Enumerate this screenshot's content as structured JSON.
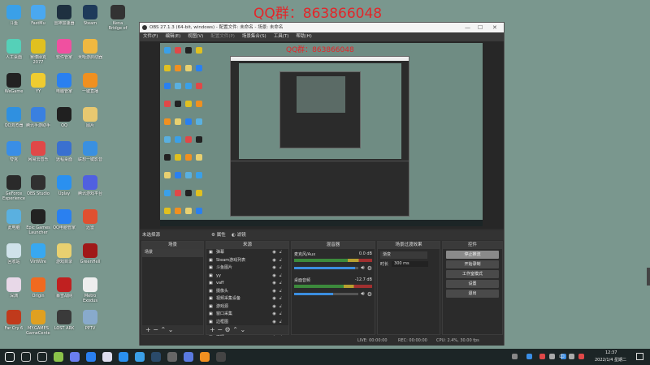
{
  "watermark": "QQ群：863866048",
  "desktop_icons": [
    {
      "label": "斗鱼",
      "color": "#3aa0e8"
    },
    {
      "label": "人工桌面",
      "color": "#55d0b8"
    },
    {
      "label": "WeGame",
      "color": "#222"
    },
    {
      "label": "QQ浏览器",
      "color": "#2f90e0"
    },
    {
      "label": "夸克",
      "color": "#3a8ee6"
    },
    {
      "label": "GeForce Experience",
      "color": "#2a2a2a"
    },
    {
      "label": "此电脑",
      "color": "#5ab0e0"
    },
    {
      "label": "回收站",
      "color": "#cfe2ea"
    },
    {
      "label": "深渊",
      "color": "#e8d8e8"
    },
    {
      "label": "Far Cry 6",
      "color": "#c03a1c"
    },
    {
      "label": "FastMu",
      "color": "#4aa8f0"
    },
    {
      "label": "赛博朋克2077",
      "color": "#e0c020"
    },
    {
      "label": "YY",
      "color": "#f0cc30"
    },
    {
      "label": "腾讯手游助手",
      "color": "#3a80e0"
    },
    {
      "label": "网易云音乐",
      "color": "#e04848"
    },
    {
      "label": "OBS Studio",
      "color": "#303030"
    },
    {
      "label": "Epic Games Launcher",
      "color": "#222"
    },
    {
      "label": "VirtWire",
      "color": "#38a8f0"
    },
    {
      "label": "Origin",
      "color": "#f06a20"
    },
    {
      "label": "MY.GAMES GameCenter",
      "color": "#e0a020"
    },
    {
      "label": "雷神加速器",
      "color": "#1e3040"
    },
    {
      "label": "软件管家",
      "color": "#f050a0"
    },
    {
      "label": "电脑管家",
      "color": "#2a80f0"
    },
    {
      "label": "QQ",
      "color": "#202020"
    },
    {
      "label": "远程桌面",
      "color": "#3a70d0"
    },
    {
      "label": "Uplay",
      "color": "#2a90f0"
    },
    {
      "label": "QQ电脑管家",
      "color": "#2a80f0"
    },
    {
      "label": "游戏目录",
      "color": "#e8d070"
    },
    {
      "label": "暴雪战网",
      "color": "#c02020"
    },
    {
      "label": "LOST ARK",
      "color": "#3a3a3a"
    },
    {
      "label": "Steam",
      "color": "#1e3a5a"
    },
    {
      "label": "米哈游启动器",
      "color": "#f0b840"
    },
    {
      "label": "一键直播",
      "color": "#f09020"
    },
    {
      "label": "图片",
      "color": "#e8c870"
    },
    {
      "label": "联想一键影音",
      "color": "#3a90e0"
    },
    {
      "label": "腾讯游戏平台",
      "color": "#5060e0"
    },
    {
      "label": "迅雷",
      "color": "#e05030"
    },
    {
      "label": "GreenHell",
      "color": "#a01818"
    },
    {
      "label": "Metro Exodus",
      "color": "#eeeeee"
    },
    {
      "label": "PPTV",
      "color": "#88aacc"
    },
    {
      "label": "Kena Bridge of Spirits",
      "color": "#333"
    }
  ],
  "obs": {
    "title": "OBS 27.1.3 (64-bit, windows) - 配置文件: 未命名 - 场景: 未命名",
    "menu": [
      "文件(F)",
      "编辑(E)",
      "视图(V)",
      "配置文件(P)",
      "场景集合(S)",
      "工具(T)",
      "帮助(H)"
    ],
    "scenebar": {
      "label": "未选择源",
      "properties": "属性",
      "filters": "滤镜"
    },
    "scenes": {
      "title": "场景",
      "items": [
        "场景"
      ]
    },
    "sources": {
      "title": "来源",
      "items": [
        "弹幕",
        "Steam游戏列表",
        "斗鱼图片",
        "yy",
        "vaff",
        "摄像头",
        "视频采集设备",
        "游戏源",
        "窗口采集",
        "边框图",
        "显示器采集",
        "下播"
      ]
    },
    "mixer": {
      "title": "混音器",
      "channels": [
        {
          "name": "麦克风/Aux",
          "db": "0.0 dB",
          "level": 0.92,
          "volume": 0.95
        },
        {
          "name": "桌面音频",
          "db": "-12.7 dB",
          "level": 0.85,
          "volume": 0.6
        }
      ]
    },
    "transitions": {
      "title": "场景过渡效果",
      "type": "渐变",
      "duration_label": "时长",
      "duration": "300 ms"
    },
    "controls": {
      "title": "控件",
      "buttons": [
        "停止推流",
        "开始录制",
        "工作室模式",
        "设置",
        "退出"
      ]
    },
    "status": {
      "live": "LIVE: 00:00:00",
      "rec": "REC: 00:00:00",
      "cpu": "CPU: 2.4%, 30.00 fps"
    }
  },
  "taskbar": {
    "time": "12:37",
    "date": "2022/1/4 星期二",
    "ime": "中"
  }
}
